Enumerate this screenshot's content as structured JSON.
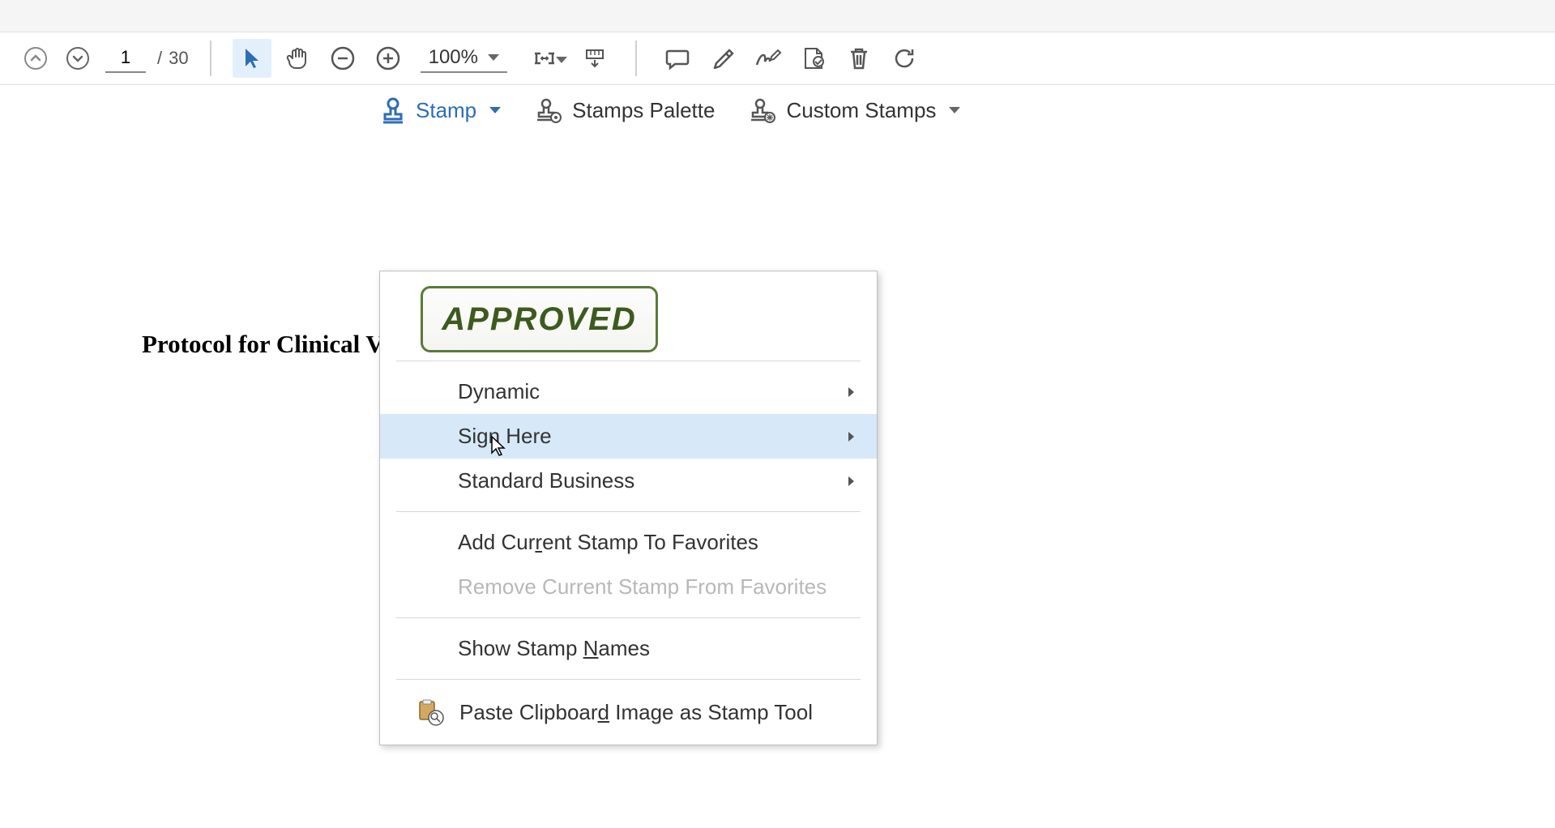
{
  "toolbar": {
    "page_current": "1",
    "page_sep": "/",
    "page_total": "30",
    "zoom_value": "100%"
  },
  "secondary": {
    "stamp_label": "Stamp",
    "stamps_palette_label": "Stamps Palette",
    "custom_stamps_label": "Custom Stamps"
  },
  "document": {
    "title": "Protocol for Clinical V"
  },
  "dropdown": {
    "approved_label": "APPROVED",
    "items": {
      "dynamic": "Dynamic",
      "sign_here": "Sign Here",
      "standard_business": "Standard Business",
      "add_favorites_pre": "Add Cur",
      "add_favorites_r": "r",
      "add_favorites_post": "ent Stamp To Favorites",
      "remove_favorites": "Remove Current Stamp From Favorites",
      "show_names_pre": "Show Stamp ",
      "show_names_n": "N",
      "show_names_post": "ames",
      "paste_clipboard_pre": "Paste Clipboar",
      "paste_clipboard_d": "d",
      "paste_clipboard_post": " Image as Stamp Tool"
    }
  },
  "icons": {
    "up_arrow": "up-arrow",
    "down_arrow": "down-arrow",
    "select_tool": "select-arrow",
    "hand_tool": "hand",
    "zoom_out": "minus-circle",
    "zoom_in": "plus-circle",
    "fit_width": "fit-width",
    "ruler": "ruler",
    "comment": "comment",
    "highlight": "highlight",
    "signature": "signature",
    "edit_pdf": "edit-pdf",
    "delete": "trash",
    "refresh": "refresh",
    "stamp": "stamp",
    "palette": "stamps-palette",
    "custom": "custom-stamps",
    "paste": "paste-clipboard"
  }
}
